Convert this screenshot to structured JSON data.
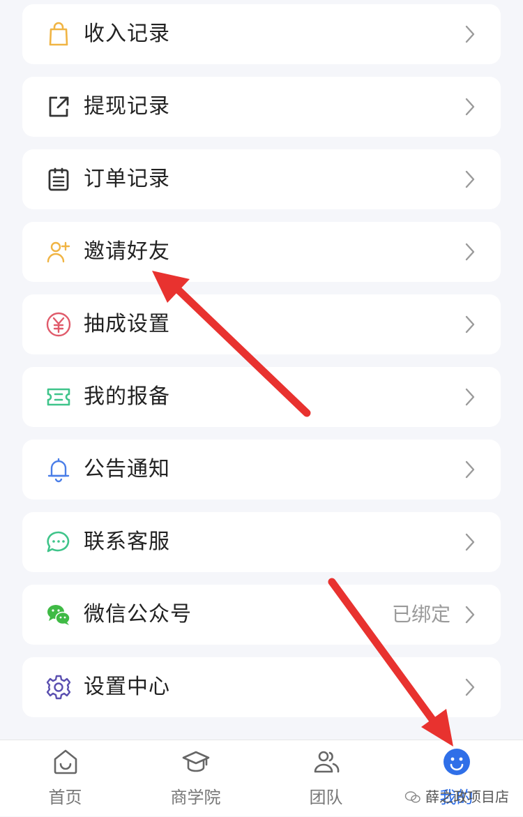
{
  "menu": {
    "items": [
      {
        "label": "收入记录",
        "icon": "shopping-bag-icon",
        "trailing": ""
      },
      {
        "label": "提现记录",
        "icon": "external-link-icon",
        "trailing": ""
      },
      {
        "label": "订单记录",
        "icon": "clipboard-list-icon",
        "trailing": ""
      },
      {
        "label": "邀请好友",
        "icon": "add-user-icon",
        "trailing": ""
      },
      {
        "label": "抽成设置",
        "icon": "yen-circle-icon",
        "trailing": ""
      },
      {
        "label": "我的报备",
        "icon": "ticket-icon",
        "trailing": ""
      },
      {
        "label": "公告通知",
        "icon": "bell-icon",
        "trailing": ""
      },
      {
        "label": "联系客服",
        "icon": "chat-bubble-icon",
        "trailing": ""
      },
      {
        "label": "微信公众号",
        "icon": "wechat-icon",
        "trailing": "已绑定"
      },
      {
        "label": "设置中心",
        "icon": "gear-icon",
        "trailing": ""
      }
    ]
  },
  "tabbar": {
    "tabs": [
      {
        "label": "首页",
        "icon": "home-icon",
        "active": false
      },
      {
        "label": "商学院",
        "icon": "graduation-cap-icon",
        "active": false
      },
      {
        "label": "团队",
        "icon": "team-icon",
        "active": false
      },
      {
        "label": "我的",
        "icon": "smiley-user-icon",
        "active": true
      }
    ]
  },
  "watermark": {
    "text": "薛之政项目店"
  },
  "colors": {
    "accent": "#2f6fe8",
    "annotation_arrow": "#e8322f",
    "card_background": "#ffffff",
    "page_background": "#f5f6fa"
  }
}
